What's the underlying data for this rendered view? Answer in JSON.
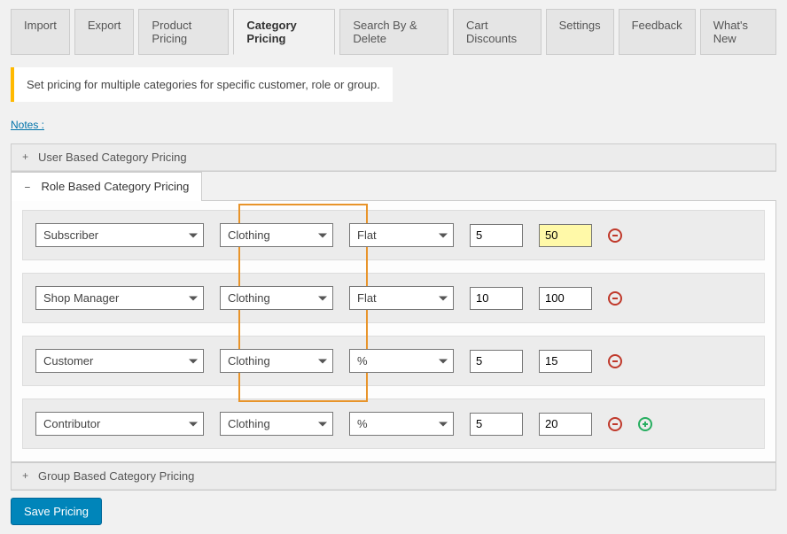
{
  "tabs": [
    "Import",
    "Export",
    "Product Pricing",
    "Category Pricing",
    "Search By & Delete",
    "Cart Discounts",
    "Settings",
    "Feedback",
    "What's New"
  ],
  "active_tab_index": 3,
  "banner": "Set pricing for multiple categories for specific customer, role or group.",
  "notes_label": "Notes :",
  "sections": {
    "user": {
      "title": "User Based Category Pricing",
      "expanded": false
    },
    "role": {
      "title": "Role Based Category Pricing",
      "expanded": true
    },
    "group": {
      "title": "Group Based Category Pricing",
      "expanded": false
    }
  },
  "rows": [
    {
      "role": "Subscriber",
      "category": "Clothing",
      "type": "Flat",
      "qty": "5",
      "price": "50",
      "price_highlight": true,
      "show_add": false
    },
    {
      "role": "Shop Manager",
      "category": "Clothing",
      "type": "Flat",
      "qty": "10",
      "price": "100",
      "price_highlight": false,
      "show_add": false
    },
    {
      "role": "Customer",
      "category": "Clothing",
      "type": "%",
      "qty": "5",
      "price": "15",
      "price_highlight": false,
      "show_add": false
    },
    {
      "role": "Contributor",
      "category": "Clothing",
      "type": "%",
      "qty": "5",
      "price": "20",
      "price_highlight": false,
      "show_add": true
    }
  ],
  "save_label": "Save Pricing"
}
